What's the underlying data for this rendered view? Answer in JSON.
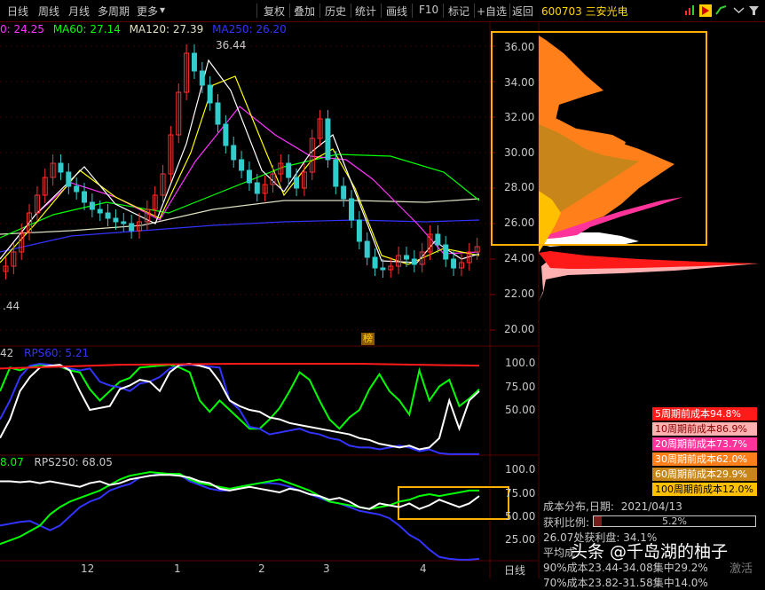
{
  "toolbar": {
    "items": [
      "日线",
      "周线",
      "月线",
      "多周期",
      "更多"
    ],
    "more_arrow": "▾",
    "right_items": [
      "复权",
      "叠加",
      "历史",
      "统计",
      "画线",
      "F10",
      "标记",
      "+自选",
      "返回"
    ],
    "stock_code": "600703",
    "stock_name": "三安光电"
  },
  "ma_labels": {
    "ma_cut": "0: 24.25",
    "ma60": "MA60: 27.14",
    "ma120": "MA120: 27.39",
    "ma250": "MA250: 26.20"
  },
  "price_labels": {
    "high": "36.44",
    "low": ".44",
    "badge": "榜"
  },
  "price_axis": [
    "36.00",
    "34.00",
    "32.00",
    "30.00",
    "28.00",
    "26.00",
    "24.00",
    "22.00",
    "20.00"
  ],
  "rps60": {
    "cut": "42",
    "label": "RPS60: 5.21"
  },
  "rps250": {
    "cut": "8.07",
    "label": "RPS250: 68.05"
  },
  "rps_axis": [
    "100.0",
    "75.00",
    "50.00"
  ],
  "rps250_axis": [
    "100.0",
    "75.00",
    "50.00",
    "25.00"
  ],
  "dates": [
    "12",
    "1",
    "2",
    "3",
    "4"
  ],
  "period_label": "日线",
  "cost_legend": [
    {
      "label": "5周期前成本94.8%",
      "bg": "#ff1a1a",
      "fg": "#ffffff"
    },
    {
      "label": "10周期前成本86.9%",
      "bg": "#ffb0b0",
      "fg": "#8b0000"
    },
    {
      "label": "20周期前成本73.7%",
      "bg": "#ff3399",
      "fg": "#ffffff"
    },
    {
      "label": "30周期前成本62.0%",
      "bg": "#ff7f1a",
      "fg": "#ffffff"
    },
    {
      "label": "60周期前成本29.9%",
      "bg": "#c8861a",
      "fg": "#ffffff"
    },
    {
      "label": "100周期前成本12.0%",
      "bg": "#ffc000",
      "fg": "#000000"
    }
  ],
  "info": {
    "dist_title": "成本分布,日期:",
    "dist_date": "2021/04/13",
    "profit_label": "获利比例:",
    "profit_value": "5.2%",
    "profit_fraction": 0.052,
    "line3": "26.07处获利盘: 34.1%",
    "line4": "平均成",
    "line5": "90%成本23.44-34.08集中29.2%",
    "line6": "70%成本23.82-31.58集中14.0%"
  },
  "watermark": "头条 @千岛湖的柚子",
  "corner_tag": "激活",
  "colors": {
    "background": "#000000",
    "border": "#5a0000",
    "up": "#ff3030",
    "down": "#33cccc",
    "ma5": "#ffffff",
    "ma10": "#ffff00",
    "ma20": "#ff33ff",
    "ma60": "#00ff00",
    "ma120": "#e0e0c0",
    "ma250": "#3333ff",
    "highlight_box": "#ffb000"
  }
}
